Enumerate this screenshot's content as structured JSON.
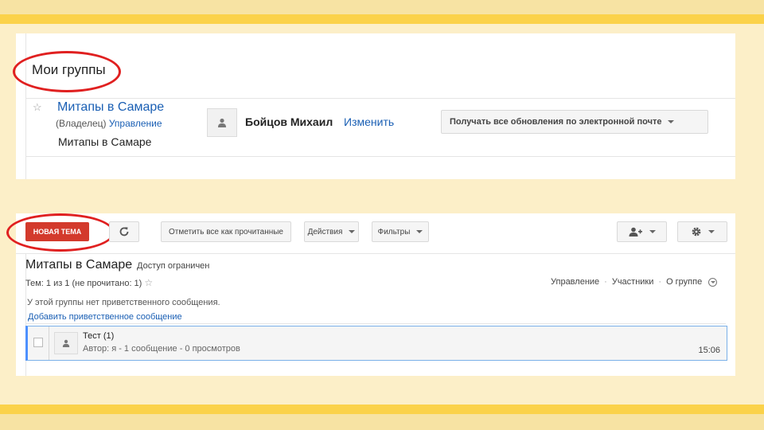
{
  "my_groups": {
    "title": "Мои группы",
    "group_name": "Митапы в Самаре",
    "owner_label": "(Владелец)",
    "manage_link": "Управление",
    "description": "Митапы в Самаре",
    "user_name": "Бойцов Михаил",
    "edit_link": "Изменить",
    "notify_dropdown": "Получать все обновления по электронной почте"
  },
  "toolbar": {
    "new_topic": "НОВАЯ ТЕМА",
    "mark_read": "Отметить все как прочитанные",
    "actions": "Действия",
    "filters": "Фильтры"
  },
  "group": {
    "title": "Митапы в Самаре",
    "access": "Доступ ограничен",
    "topics_count": "Тем: 1 из 1 (не прочитано: 1)",
    "nav": {
      "manage": "Управление",
      "members": "Участники",
      "about": "О группе"
    },
    "welcome_note": "У этой группы нет приветственного сообщения.",
    "add_welcome": "Добавить приветственное сообщение"
  },
  "topics": [
    {
      "title": "Тест  (1)",
      "meta": "Автор: я - 1 сообщение - 0 просмотров",
      "time": "15:06"
    }
  ],
  "colors": {
    "accent_red": "#d33a2c",
    "link_blue": "#1a5fb4",
    "highlight_oval": "#e02020",
    "background_yellow": "#fbd24a"
  }
}
